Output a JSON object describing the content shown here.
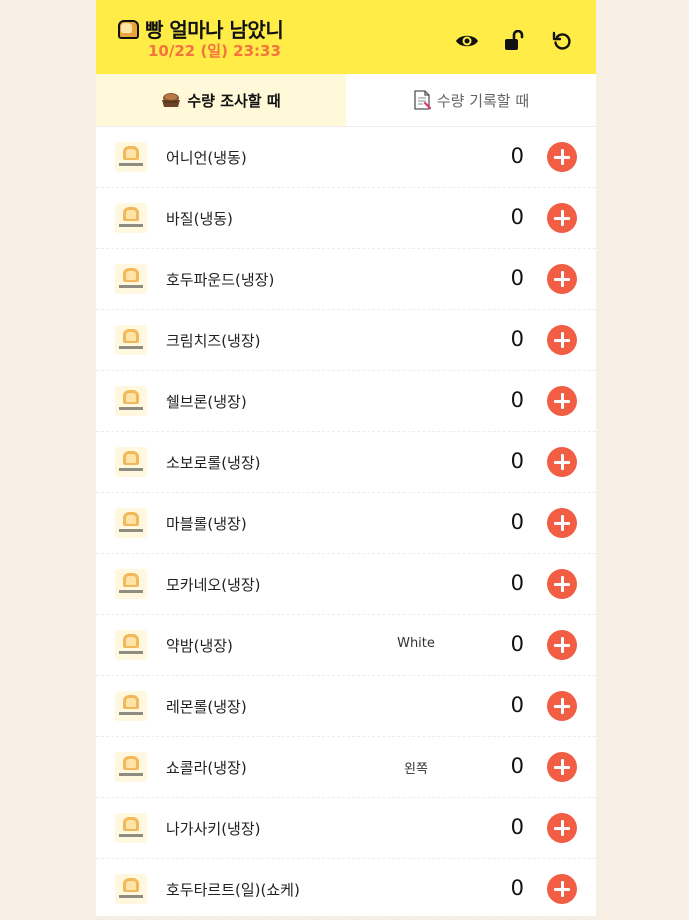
{
  "header": {
    "title": "빵 얼마나 남았니",
    "date": "10/22 (일) 23:33",
    "bg_color": "#ffec47",
    "date_color": "#f4733f",
    "icons": [
      "eye-icon",
      "unlock-icon",
      "refresh-icon"
    ]
  },
  "tabs": [
    {
      "label": "수량 조사할 때",
      "icon": "bread-basket-icon",
      "active": true
    },
    {
      "label": "수량 기록할 때",
      "icon": "memo-icon",
      "active": false
    }
  ],
  "items": [
    {
      "name": "어니언(냉동)",
      "note": "",
      "count": "0"
    },
    {
      "name": "바질(냉동)",
      "note": "",
      "count": "0"
    },
    {
      "name": "호두파운드(냉장)",
      "note": "",
      "count": "0"
    },
    {
      "name": "크림치즈(냉장)",
      "note": "",
      "count": "0"
    },
    {
      "name": "쉘브론(냉장)",
      "note": "",
      "count": "0"
    },
    {
      "name": "소보로롤(냉장)",
      "note": "",
      "count": "0"
    },
    {
      "name": "마블롤(냉장)",
      "note": "",
      "count": "0"
    },
    {
      "name": "모카네오(냉장)",
      "note": "",
      "count": "0"
    },
    {
      "name": "약밤(냉장)",
      "note": "White",
      "count": "0"
    },
    {
      "name": "레몬롤(냉장)",
      "note": "",
      "count": "0"
    },
    {
      "name": "쇼콜라(냉장)",
      "note": "왼쪽",
      "count": "0"
    },
    {
      "name": "나가사키(냉장)",
      "note": "",
      "count": "0"
    },
    {
      "name": "호두타르트(일)(쇼케)",
      "note": "",
      "count": "0"
    }
  ],
  "accent_color": "#f25e44"
}
